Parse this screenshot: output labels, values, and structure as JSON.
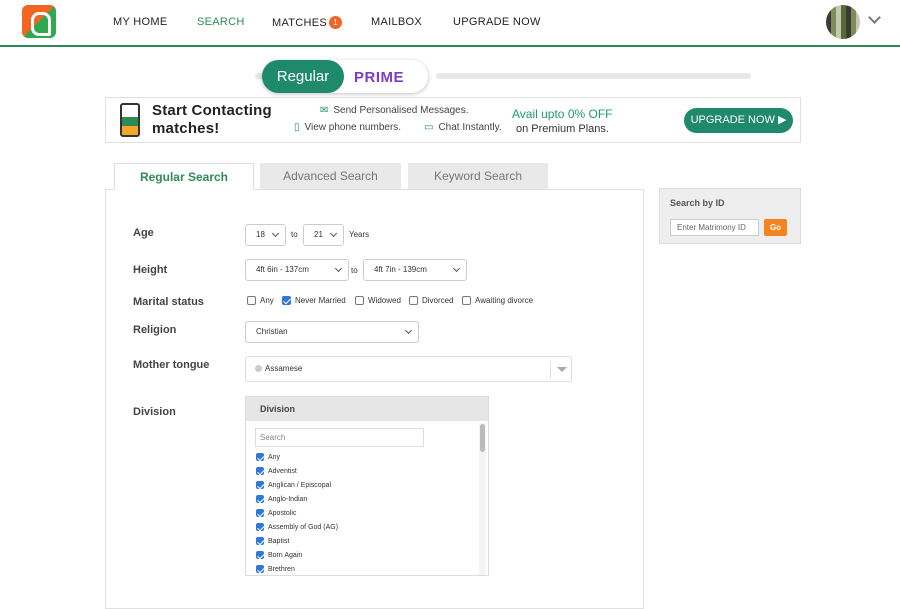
{
  "nav": {
    "items": [
      "MY HOME",
      "SEARCH",
      "MATCHES",
      "MAILBOX",
      "UPGRADE NOW"
    ],
    "active": "SEARCH",
    "matches_badge": "1"
  },
  "toggle": {
    "regular": "Regular",
    "prime": "PRIME"
  },
  "banner": {
    "title_line1": "Start Contacting",
    "title_line2": "matches!",
    "feature1": "Send Personalised Messages.",
    "feature2": "View phone numbers.",
    "feature3": "Chat Instantly.",
    "avail": "Avail upto 0% OFF",
    "plans": "on Premium Plans.",
    "button": "UPGRADE NOW ▶"
  },
  "tabs": [
    "Regular Search",
    "Advanced Search",
    "Keyword Search"
  ],
  "form": {
    "age_label": "Age",
    "age_from": "18",
    "age_to": "21",
    "to": "to",
    "years": "Years",
    "height_label": "Height",
    "height_from": "4ft 6in - 137cm",
    "height_to": "4ft 7in - 139cm",
    "marital_label": "Marital status",
    "marital_options": [
      {
        "label": "Any",
        "checked": false
      },
      {
        "label": "Never Married",
        "checked": true
      },
      {
        "label": "Widowed",
        "checked": false
      },
      {
        "label": "Divorced",
        "checked": false
      },
      {
        "label": "Awaiting divorce",
        "checked": false
      }
    ],
    "religion_label": "Religion",
    "religion_value": "Christian",
    "mother_tongue_label": "Mother tongue",
    "mother_tongue_value": "Assamese",
    "division_label": "Division",
    "division_header": "Division",
    "division_search_placeholder": "Search",
    "division_items": [
      "Any",
      "Adventist",
      "Anglican / Episcopal",
      "Anglo-Indian",
      "Apostolic",
      "Assembly of God (AG)",
      "Baptist",
      "Born Again",
      "Brethren"
    ]
  },
  "search_by_id": {
    "title": "Search by ID",
    "placeholder": "Enter Matrimony ID",
    "button": "Go"
  },
  "colors": {
    "brand_green": "#1f8a6b",
    "prime_purple": "#7d3cc8",
    "accent_orange": "#f5831f",
    "check_blue": "#2f78d6"
  },
  "icons": [
    "brand-logo-icon",
    "user-avatar-icon",
    "chevron-down-icon",
    "mail-icon",
    "phone-icon",
    "chat-icon"
  ]
}
